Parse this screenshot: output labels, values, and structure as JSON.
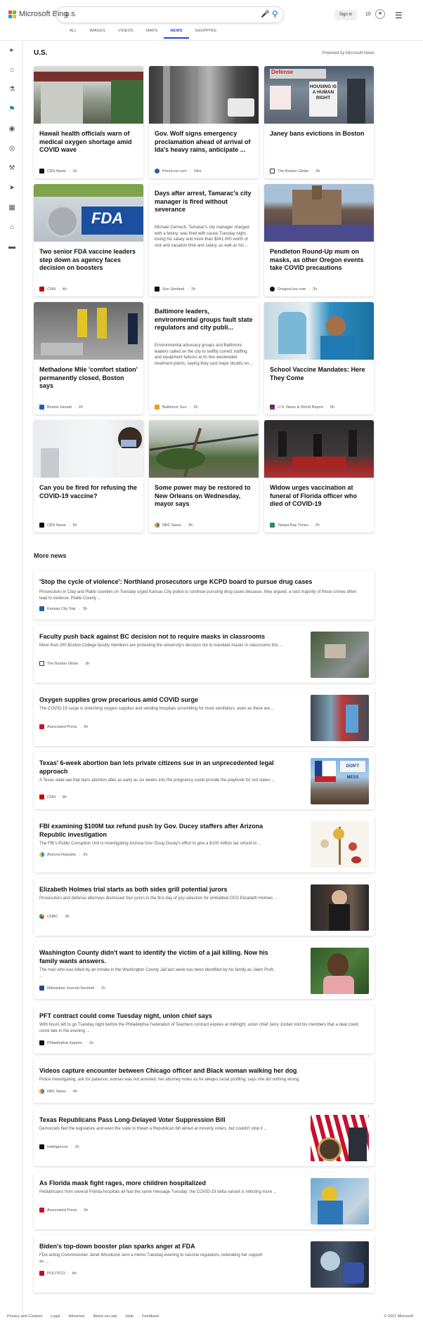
{
  "header": {
    "brand": "Microsoft Bing",
    "query": "U.S.",
    "signin": "Sign in",
    "points": "10",
    "tabs": [
      "ALL",
      "IMAGES",
      "VIDEOS",
      "MAPS",
      "NEWS",
      "SHOPPING"
    ],
    "active_tab": "NEWS"
  },
  "rail": {
    "icons": [
      "expand-icon",
      "home-icon",
      "flask-icon",
      "flag-icon",
      "location-icon",
      "globe-icon",
      "gavel-icon",
      "rocket-icon",
      "film-icon",
      "bank-icon",
      "card-icon"
    ]
  },
  "section": {
    "title": "U.S.",
    "powered": "Powered by Microsoft News"
  },
  "cards": [
    {
      "title": "Hawaii health officials warn of medical oxygen shortage amid COVID wave",
      "source": "CBS News",
      "time": "1h",
      "snippet": ""
    },
    {
      "title": "Gov. Wolf signs emergency proclamation ahead of arrival of Ida's heavy rains, anticipate ...",
      "source": "PennLive.com",
      "time": "24m",
      "snippet": ""
    },
    {
      "title": "Janey bans evictions in Boston",
      "source": "The Boston Globe",
      "time": "2h",
      "snippet": ""
    },
    {
      "title": "Two senior FDA vaccine leaders step down as agency faces decision on boosters",
      "source": "CNN",
      "time": "4h",
      "snippet": ""
    },
    {
      "title": "Days after arrest, Tamarac's city manager is fired without severance",
      "source": "Sun Sentinel",
      "time": "2h",
      "snippet": "Michael Cernech, Tamarac's city manager charged with a felony, was fired with cause Tuesday night, losing his salary and more than $341,000 worth of sick and vacation time and salary, as well as his ..."
    },
    {
      "title": "Pendleton Round-Up mum on masks, as other Oregon events take COVID precautions",
      "source": "OregonLive.com",
      "time": "2h",
      "snippet": ""
    },
    {
      "title": "Methadone Mile 'comfort station' permanently closed, Boston says",
      "source": "Boston Herald",
      "time": "2h",
      "snippet": ""
    },
    {
      "title": "Baltimore leaders, environmental groups fault state regulators and city publi...",
      "source": "Baltimore Sun",
      "time": "2h",
      "snippet": "Environmental advocacy groups and Baltimore leaders called on the city to swiftly correct staffing and equipment failures at its two wastewater treatment plants, saying they cast major doubts on ..."
    },
    {
      "title": "School Vaccine Mandates: Here They Come",
      "source": "U.S. News & World Report",
      "time": "5h",
      "snippet": ""
    },
    {
      "title": "Can you be fired for refusing the COVID-19 vaccine?",
      "source": "CBS News",
      "time": "5h",
      "snippet": ""
    },
    {
      "title": "Some power may be restored to New Orleans on Wednesday, mayor says",
      "source": "NBC News",
      "time": "3h",
      "snippet": ""
    },
    {
      "title": "Widow urges vaccination at funeral of Florida officer who died of COVID-19",
      "source": "Tampa Bay Times",
      "time": "2h",
      "snippet": ""
    }
  ],
  "more_news": {
    "title": "More news",
    "items": [
      {
        "title": "'Stop the cycle of violence': Northland prosecutors urge KCPD board to pursue drug cases",
        "snippet": "Prosecutors in Clay and Platte counties on Tuesday urged Kansas City police to continue pursuing drug cases because, they argued, a vast majority of those crimes often lead to violence. Platte County ...",
        "source": "Kansas City Star",
        "time": "3h"
      },
      {
        "title": "Faculty push back against BC decision not to require masks in classrooms",
        "snippet": "More than 200 Boston College faculty members are protesting the university's decision not to mandate masks in classrooms this ...",
        "source": "The Boston Globe",
        "time": "3h"
      },
      {
        "title": "Oxygen supplies grow precarious amid COVID surge",
        "snippet": "The COVID-19 surge is stretching oxygen supplies and sending hospitals scrambling for more ventilators, even as there are ...",
        "source": "Associated Press",
        "time": "6h"
      },
      {
        "title": "Texas' 6-week abortion ban lets private citizens sue in an unprecedented legal approach",
        "snippet": "A Texas state law that bans abortion after as early as six weeks into the pregnancy could provide the playbook for red states ...",
        "source": "CNN",
        "time": "8h"
      },
      {
        "title": "FBI examining $100M tax refund push by Gov. Ducey staffers after Arizona Republic investigation",
        "snippet": "The FBI's Public Corruption Unit is investigating Arizona Gov. Doug Ducey's effort to give a $100 million tax refund to ...",
        "source": "Arizona Republic",
        "time": "2h"
      },
      {
        "title": "Elizabeth Holmes trial starts as both sides grill potential jurors",
        "snippet": "Prosecutors and defense attorneys dismissed four jurors in the first day of jury selection for embattled CEO Elizabeth Holmes ...",
        "source": "CNBC",
        "time": "3h"
      },
      {
        "title": "Washington County didn't want to identify the victim of a jail killing. Now his family wants answers.",
        "snippet": "The man who was killed by an inmate in the Washington County Jail last week has been identified by his family as Jalen Proft, ...",
        "source": "Milwaukee Journal-Sentinel",
        "time": "1h"
      },
      {
        "title": "PFT contract could come Tuesday night, union chief says",
        "snippet": "With hours left to go Tuesday night before the Philadelphia Federation of Teachers contract expires at midnight, union chief Jerry Jordan told his members that a deal could come late in the evening ...",
        "source": "Philadelphia Inquirer",
        "time": "1h"
      },
      {
        "title": "Videos capture encounter between Chicago officer and Black woman walking her dog",
        "snippet": "Police investigating, ask for patience; woman was not arrested, her attorney notes as he alleges racial profiling, says she did nothing wrong.",
        "source": "NBC News",
        "time": "4h"
      },
      {
        "title": "Texas Republicans Pass Long-Delayed Voter Suppression Bill",
        "snippet": "Democrats fled the legislature and even the state to thwart a Republican bill aimed at minority voters, but couldn't stop it ...",
        "source": "Intelligencer",
        "time": "2h"
      },
      {
        "title": "As Florida mask fight rages, more children hospitalized",
        "snippet": "Pediatricians from several Florida hospitals all had the same message Tuesday: the COVID-19 delta variant is infecting more ...",
        "source": "Associated Press",
        "time": "5h"
      },
      {
        "title": "Biden's top-down booster plan sparks anger at FDA",
        "snippet": "FDA acting Commissioner Janet Woodcock sent a memo Tuesday evening to vaccine regulators, reiterating her support as ...",
        "source": "POLITICO",
        "time": "4h"
      }
    ]
  },
  "image_text": {
    "housing_sign": "HOUSING IS A HUMAN RIGHT",
    "fda_sign": "FDA",
    "dont_mess": "DON'T MESS"
  },
  "footer": {
    "links": [
      "Privacy and Cookies",
      "Legal",
      "Advertise",
      "About our ads",
      "Help",
      "Feedback"
    ],
    "copyright": "© 2021 Microsoft"
  },
  "colors": {
    "accent": "#174ae4",
    "logo": [
      "#f25022",
      "#7fba00",
      "#00a4ef",
      "#ffb900"
    ]
  }
}
